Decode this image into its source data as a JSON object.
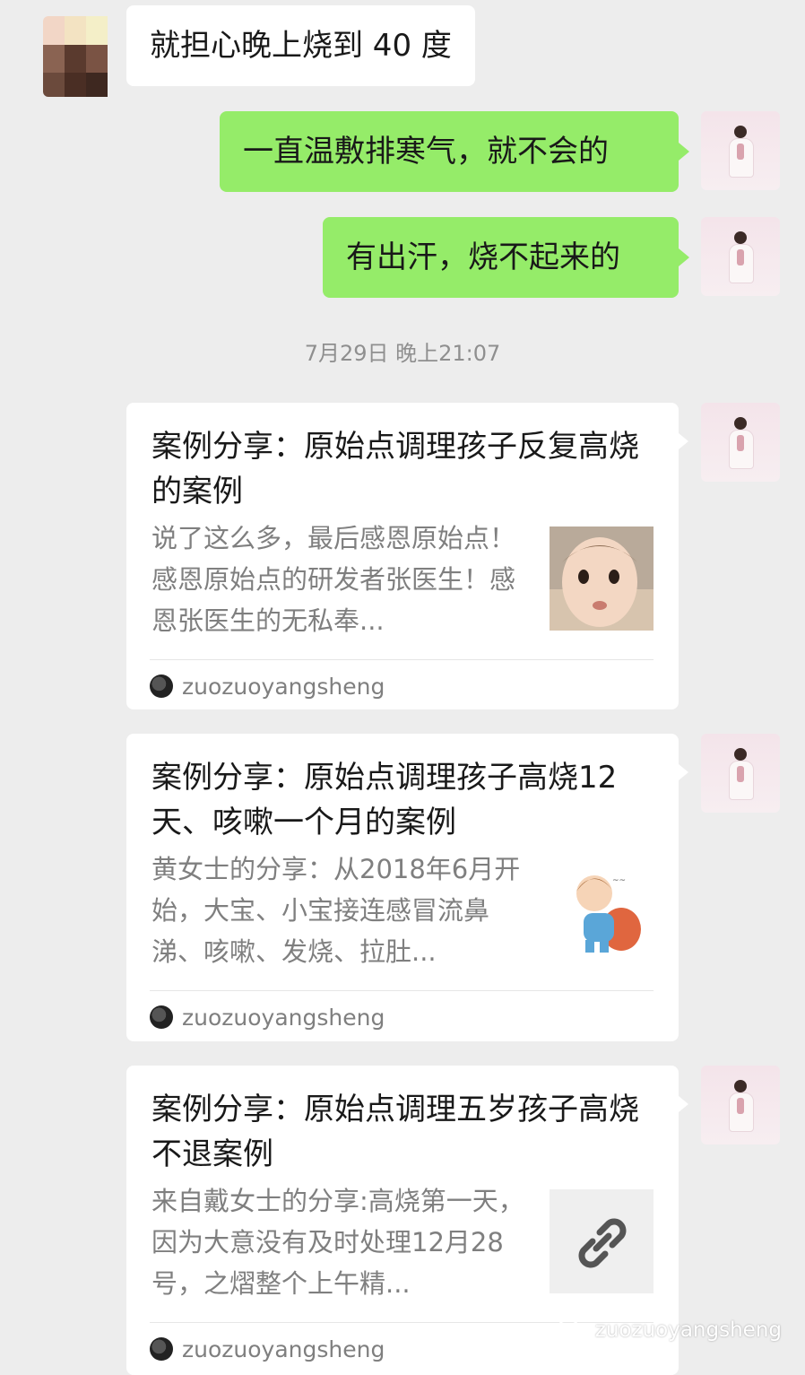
{
  "messages": {
    "incoming": "就担心晚上烧到 40 度",
    "outgoing_1": "一直温敷排寒气，就不会的",
    "outgoing_2": "有出汗，烧不起来的"
  },
  "timestamp": "7月29日 晚上21:07",
  "cards": [
    {
      "title": "案例分享：原始点调理孩子反复高烧的案例",
      "description": "说了这么多，最后感恩原始点！感恩原始点的研发者张医生！感恩张医生的无私奉...",
      "source": "zuozuoyangsheng",
      "thumbnail": "baby-photo"
    },
    {
      "title": "案例分享：原始点调理孩子高烧12天、咳嗽一个月的案例",
      "description": "黄女士的分享：从2018年6月开始，大宝、小宝接连感冒流鼻涕、咳嗽、发烧、拉肚...",
      "source": "zuozuoyangsheng",
      "thumbnail": "cartoon-sick-child"
    },
    {
      "title": "案例分享：原始点调理五岁孩子高烧不退案例",
      "description": "来自戴女士的分享:高烧第一天，因为大意没有及时处理12月28号，之熠整个上午精...",
      "source": "zuozuoyangsheng",
      "thumbnail": "link-icon"
    }
  ],
  "watermark": "zuozuoyangsheng",
  "colors": {
    "background": "#ededed",
    "outgoing_bubble": "#95ec69",
    "incoming_bubble": "#ffffff",
    "secondary_text": "#7f7f7f"
  }
}
